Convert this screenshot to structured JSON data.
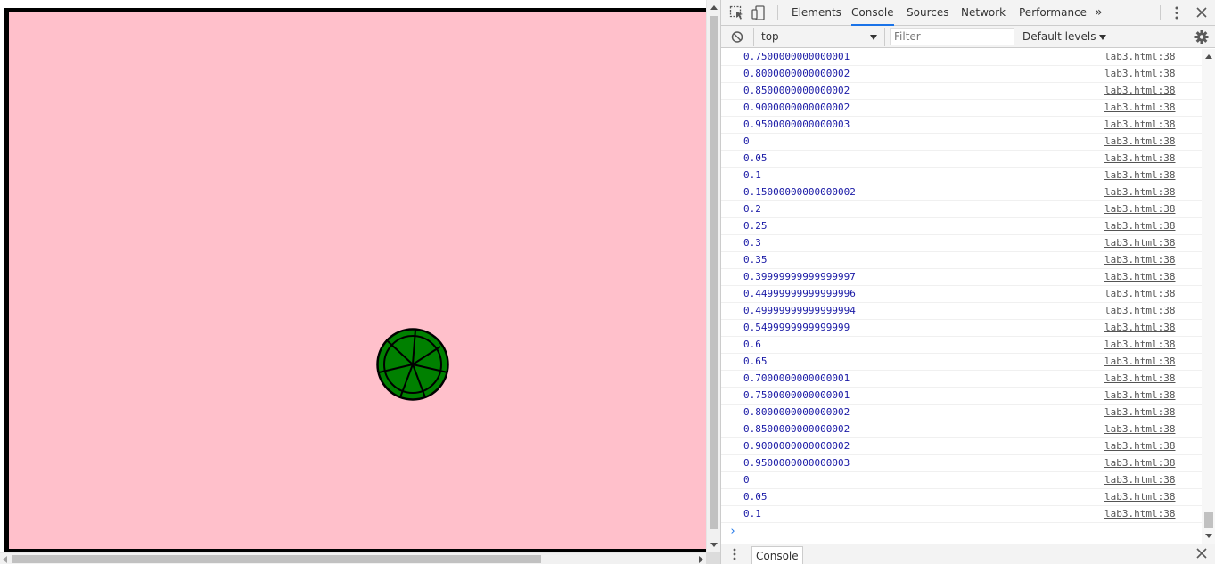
{
  "devtools": {
    "tabs": [
      {
        "label": "Elements"
      },
      {
        "label": "Console"
      },
      {
        "label": "Sources"
      },
      {
        "label": "Network"
      },
      {
        "label": "Performance"
      }
    ],
    "more_tabs": "»",
    "active_tab": "Console",
    "toolbar": {
      "context": "top",
      "filter_placeholder": "Filter",
      "levels": "Default levels"
    },
    "console_rows": [
      {
        "value": "0.7500000000000001",
        "source": "lab3.html:38"
      },
      {
        "value": "0.8000000000000002",
        "source": "lab3.html:38"
      },
      {
        "value": "0.8500000000000002",
        "source": "lab3.html:38"
      },
      {
        "value": "0.9000000000000002",
        "source": "lab3.html:38"
      },
      {
        "value": "0.9500000000000003",
        "source": "lab3.html:38"
      },
      {
        "value": "0",
        "source": "lab3.html:38"
      },
      {
        "value": "0.05",
        "source": "lab3.html:38"
      },
      {
        "value": "0.1",
        "source": "lab3.html:38"
      },
      {
        "value": "0.15000000000000002",
        "source": "lab3.html:38"
      },
      {
        "value": "0.2",
        "source": "lab3.html:38"
      },
      {
        "value": "0.25",
        "source": "lab3.html:38"
      },
      {
        "value": "0.3",
        "source": "lab3.html:38"
      },
      {
        "value": "0.35",
        "source": "lab3.html:38"
      },
      {
        "value": "0.39999999999999997",
        "source": "lab3.html:38"
      },
      {
        "value": "0.44999999999999996",
        "source": "lab3.html:38"
      },
      {
        "value": "0.49999999999999994",
        "source": "lab3.html:38"
      },
      {
        "value": "0.5499999999999999",
        "source": "lab3.html:38"
      },
      {
        "value": "0.6",
        "source": "lab3.html:38"
      },
      {
        "value": "0.65",
        "source": "lab3.html:38"
      },
      {
        "value": "0.7000000000000001",
        "source": "lab3.html:38"
      },
      {
        "value": "0.7500000000000001",
        "source": "lab3.html:38"
      },
      {
        "value": "0.8000000000000002",
        "source": "lab3.html:38"
      },
      {
        "value": "0.8500000000000002",
        "source": "lab3.html:38"
      },
      {
        "value": "0.9000000000000002",
        "source": "lab3.html:38"
      },
      {
        "value": "0.9500000000000003",
        "source": "lab3.html:38"
      },
      {
        "value": "0",
        "source": "lab3.html:38"
      },
      {
        "value": "0.05",
        "source": "lab3.html:38"
      },
      {
        "value": "0.1",
        "source": "lab3.html:38"
      }
    ],
    "prompt_symbol": "›",
    "drawer_tab": "Console"
  },
  "page": {
    "canvas_background": "#ffc0cb",
    "ball_color": "#008000"
  }
}
